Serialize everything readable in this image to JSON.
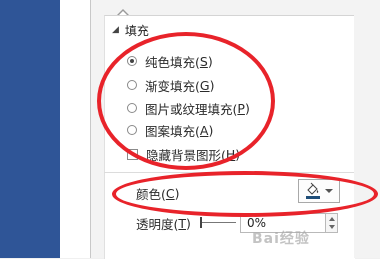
{
  "fill": {
    "section_title": "填充",
    "options": [
      {
        "label": "纯色填充(",
        "key": "S",
        "checked": true
      },
      {
        "label": "渐变填充(",
        "key": "G",
        "checked": false
      },
      {
        "label": "图片或纹理填充(",
        "key": "P",
        "checked": false
      },
      {
        "label": "图案填充(",
        "key": "A",
        "checked": false
      }
    ],
    "hide_background": {
      "label": "隐藏背景图形(",
      "key": "H",
      "checked": false
    }
  },
  "color": {
    "label": "颜色(",
    "key": "C",
    "close": ")",
    "swatch": "#1f4e79"
  },
  "transparency": {
    "label": "透明度(",
    "key": "T",
    "close": ")",
    "value": "0%"
  },
  "colors": {
    "annotation": "#e8232a",
    "sidebar": "#2f5597"
  },
  "watermark": "Bai经验"
}
